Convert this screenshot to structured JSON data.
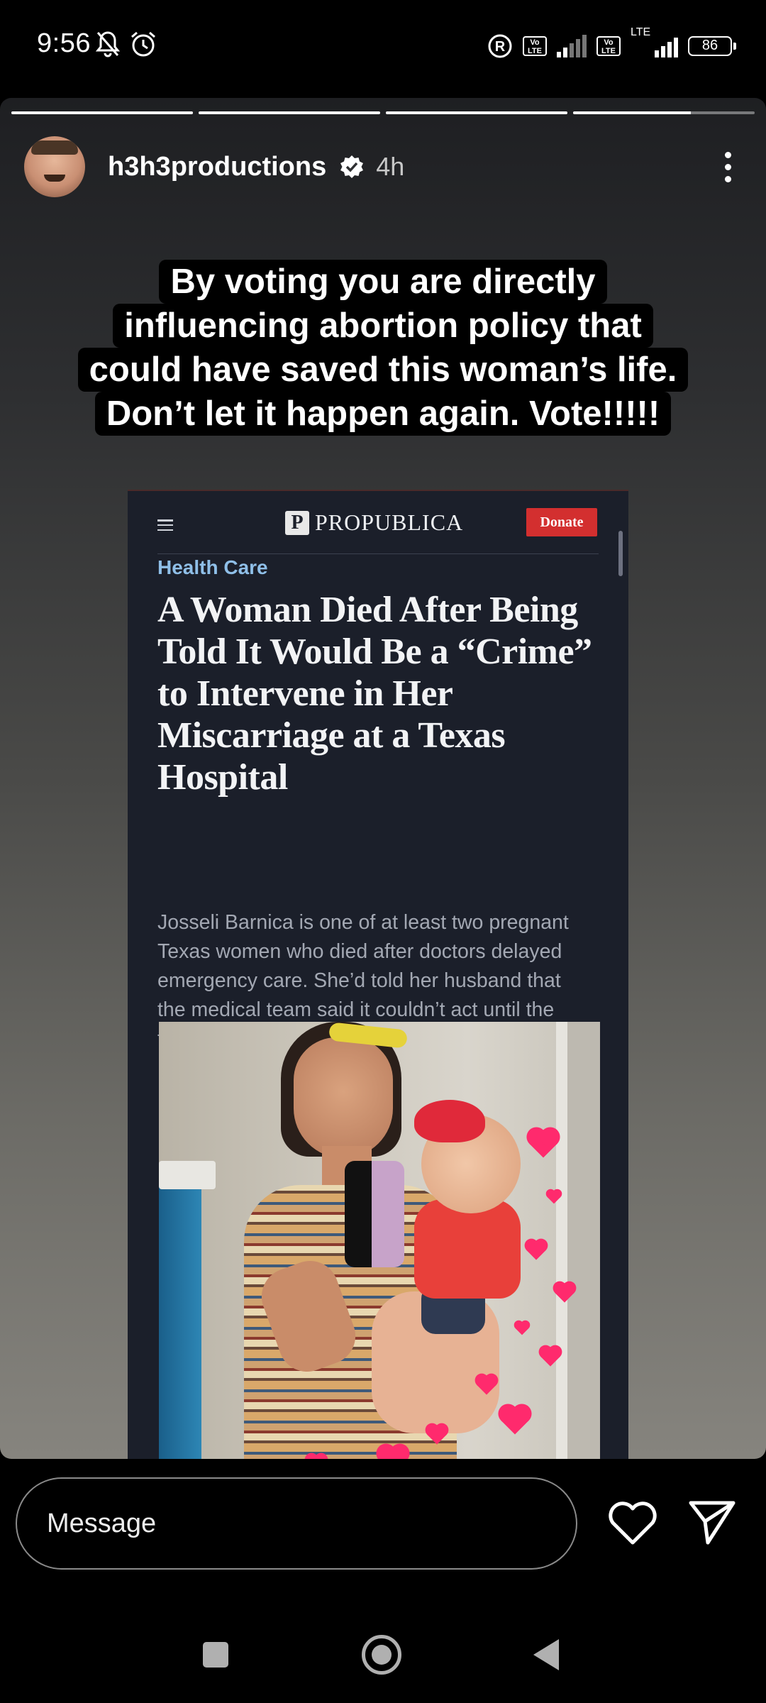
{
  "status_bar": {
    "time": "9:56",
    "network_badge_1": "Vo LTE",
    "network_badge_2": "Vo LTE",
    "lte_label": "LTE",
    "battery": "86"
  },
  "story": {
    "progress": [
      1.0,
      1.0,
      1.0,
      0.65
    ],
    "username": "h3h3productions",
    "verified": true,
    "time_ago": "4h",
    "caption_lines": [
      "By voting you are directly",
      "influencing abortion policy that",
      "could have saved this woman’s life.",
      "Don’t let it happen again. Vote!!!!!"
    ],
    "article": {
      "brand": "PROPUBLICA",
      "brand_mark": "P",
      "donate": "Donate",
      "section": "Health Care",
      "headline": "A Woman Died After Being Told It Would Be a “Crime” to Intervene in Her Miscarriage at a Texas Hospital",
      "deck": "Josseli Barnica is one of at least two pregnant Texas women who died after doctors delayed emergency care. She’d told her husband that the medical team said it couldn’t act until the fetal heartbeat stopped."
    }
  },
  "bottom": {
    "message_placeholder": "Message"
  },
  "icons": {
    "dnd": "bell-off-icon",
    "alarm": "alarm-icon",
    "registered": "registered-icon",
    "verified": "verified-badge-icon",
    "more": "more-vertical-icon",
    "like": "heart-icon",
    "send": "send-icon"
  },
  "colors": {
    "donate": "#d32f2f",
    "section": "#8fbfe8",
    "article_bg": "#1b1f2a",
    "hearts": "#ff2a6d"
  }
}
